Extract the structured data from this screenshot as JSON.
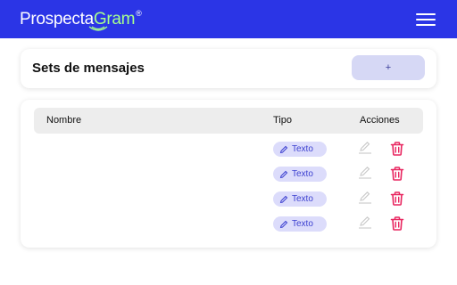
{
  "header": {
    "logo_part1": "Prospecta",
    "logo_part2": "Gram",
    "logo_reg": "®",
    "bg_color": "#2b35e6",
    "accent_color": "#a6ff8f"
  },
  "sets_card": {
    "title": "Sets de mensajes",
    "add_label": "+"
  },
  "table": {
    "columns": {
      "nombre": "Nombre",
      "tipo": "Tipo",
      "acciones": "Acciones"
    },
    "rows": [
      {
        "nombre": "",
        "tipo": "Texto"
      },
      {
        "nombre": "",
        "tipo": "Texto"
      },
      {
        "nombre": "",
        "tipo": "Texto"
      },
      {
        "nombre": "",
        "tipo": "Texto"
      }
    ]
  },
  "icons": {
    "menu": "hamburger-menu-icon",
    "tipo_chip": "pencil-icon",
    "edit": "edit-icon",
    "delete": "trash-icon"
  },
  "colors": {
    "chip_bg": "#dcdcfb",
    "chip_text": "#3b3fd0",
    "delete": "#e8245e",
    "edit_disabled": "#c8c8c8"
  }
}
